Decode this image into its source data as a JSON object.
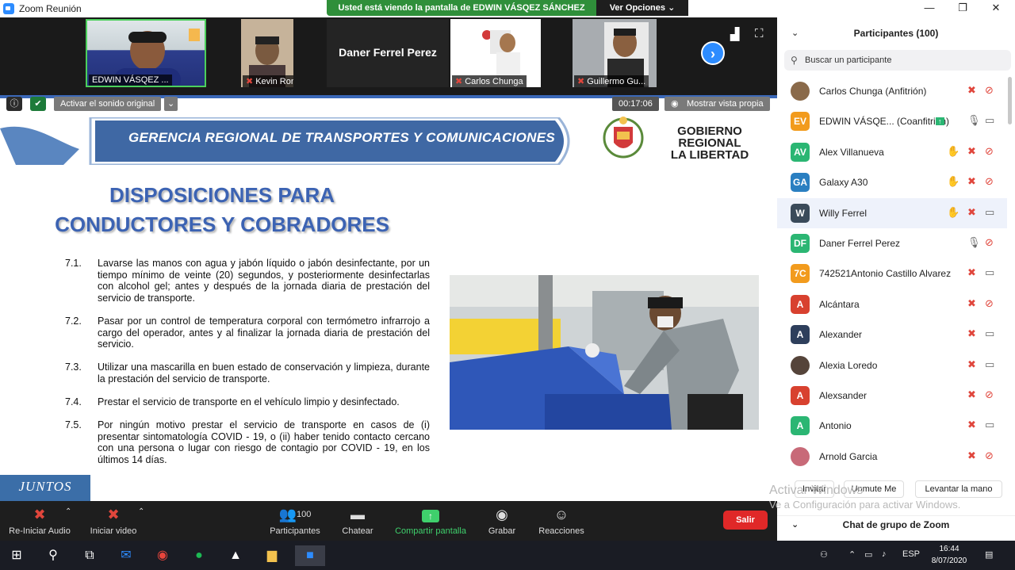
{
  "window": {
    "title": "Zoom Reunión",
    "minimize": "—",
    "restore": "❐",
    "close": "✕"
  },
  "share_banner": {
    "text": "Usted está viendo la pantalla de EDWIN VÁSQEZ SÁNCHEZ",
    "options": "Ver Opciones ⌄"
  },
  "video_strip": {
    "tiles": [
      {
        "label": "EDWIN VÁSQEZ ...",
        "muted": false
      },
      {
        "label": "Kevin Ronald...",
        "muted": true
      },
      {
        "name": "Daner Ferrel Perez"
      },
      {
        "label": "Carlos Chunga",
        "muted": true
      },
      {
        "label": "Guillermo Gu...",
        "muted": true
      }
    ],
    "next_glyph": "›"
  },
  "slide_controls": {
    "original_sound": "Activar el sonido original",
    "timer": "00:17:06",
    "show_self": "Mostrar vista propia"
  },
  "slide": {
    "header": "GERENCIA REGIONAL DE TRANSPORTES Y COMUNICACIONES",
    "gov_line1": "GOBIERNO REGIONAL",
    "gov_line2": "LA LIBERTAD",
    "title_line1": "DISPOSICIONES PARA",
    "title_line2": "CONDUCTORES Y COBRADORES",
    "items": [
      {
        "num": "7.1.",
        "text": "Lavarse las manos con agua y jabón líquido o jabón desinfectante, por un tiempo mínimo de veinte (20) segundos, y posteriormente desinfectarlas con alcohol gel; antes y después de la jornada diaria de prestación del servicio de transporte."
      },
      {
        "num": "7.2.",
        "text": "Pasar por un control de temperatura corporal con termómetro infrarrojo a cargo del operador, antes y al finalizar la jornada diaria de prestación del servicio."
      },
      {
        "num": "7.3.",
        "text": "Utilizar una mascarilla en buen estado de conservación y limpieza, durante la prestación del servicio de transporte."
      },
      {
        "num": "7.4.",
        "text": "Prestar el servicio de transporte en el vehículo limpio y desinfectado."
      },
      {
        "num": "7.5.",
        "text": "Por ningún motivo prestar el servicio de transporte en casos de (i) presentar sintomatología COVID - 19, o (ii) haber tenido contacto cercano con una persona o lugar con riesgo de contagio por COVID - 19, en los últimos 14 días."
      }
    ],
    "footer_logo": "JUNTOS"
  },
  "controls": {
    "audio": "Re-Iniciar Audio",
    "video": "Iniciar video",
    "participants": "Participantes",
    "participants_count": "100",
    "chat": "Chatear",
    "share": "Compartir pantalla",
    "record": "Grabar",
    "reactions": "Reacciones",
    "leave": "Salir"
  },
  "panel": {
    "title": "Participantes (100)",
    "search_placeholder": "Buscar un participante",
    "participants": [
      {
        "name": "Carlos Chunga (Anfitrión)",
        "initials": "",
        "color": "#8a6a4a",
        "photo": true,
        "hand": false,
        "mic": "muted",
        "cam": "off"
      },
      {
        "name": "EDWIN VÁSQE...  (Coanfitrión)",
        "initials": "EV",
        "color": "#f29b1d",
        "hand": false,
        "mic": "on",
        "cam": "on",
        "share": true
      },
      {
        "name": "Alex Villanueva",
        "initials": "AV",
        "color": "#2bb673",
        "hand": true,
        "mic": "muted",
        "cam": "off"
      },
      {
        "name": "Galaxy A30",
        "initials": "GA",
        "color": "#2a7fc1",
        "hand": true,
        "mic": "muted",
        "cam": "off"
      },
      {
        "name": "Willy Ferrel",
        "initials": "W",
        "color": "#3a4a5a",
        "hand": true,
        "mic": "muted",
        "cam": "on",
        "selected": true
      },
      {
        "name": "Daner Ferrel Perez",
        "initials": "DF",
        "color": "#2bb673",
        "hand": false,
        "mic": "on",
        "cam": "off"
      },
      {
        "name": "742521Antonio Castillo Alvarez",
        "initials": "7C",
        "color": "#f29b1d",
        "hand": false,
        "mic": "muted",
        "cam": "on"
      },
      {
        "name": "Alcántara",
        "initials": "A",
        "color": "#d8412f",
        "hand": false,
        "mic": "muted",
        "cam": "off"
      },
      {
        "name": "Alexander",
        "initials": "A",
        "color": "#2e3f5c",
        "hand": false,
        "mic": "muted",
        "cam": "on"
      },
      {
        "name": "Alexia Loredo",
        "initials": "",
        "color": "#55443a",
        "photo": true,
        "hand": false,
        "mic": "muted",
        "cam": "on"
      },
      {
        "name": "Alexsander",
        "initials": "A",
        "color": "#d8412f",
        "hand": false,
        "mic": "muted",
        "cam": "off"
      },
      {
        "name": "Antonio",
        "initials": "A",
        "color": "#2bb673",
        "hand": false,
        "mic": "muted",
        "cam": "on"
      },
      {
        "name": "Arnold Garcia",
        "initials": "",
        "color": "#c86a78",
        "photo": true,
        "hand": false,
        "mic": "muted",
        "cam": "off"
      }
    ],
    "invite": "Invitar",
    "unmute": "Unmute Me",
    "raise": "Levantar la mano",
    "watermark1": "Activar Windows",
    "watermark2": "Ve a Configuración para activar Windows.",
    "chat": "Chat de grupo de Zoom"
  },
  "taskbar": {
    "lang": "ESP",
    "time": "16:44",
    "date": "8/07/2020"
  },
  "colors": {
    "zoom_blue": "#2d8cff",
    "share_green": "#2f8f3a",
    "slide_title_blue": "#3c63b3",
    "leave_red": "#e02828"
  }
}
